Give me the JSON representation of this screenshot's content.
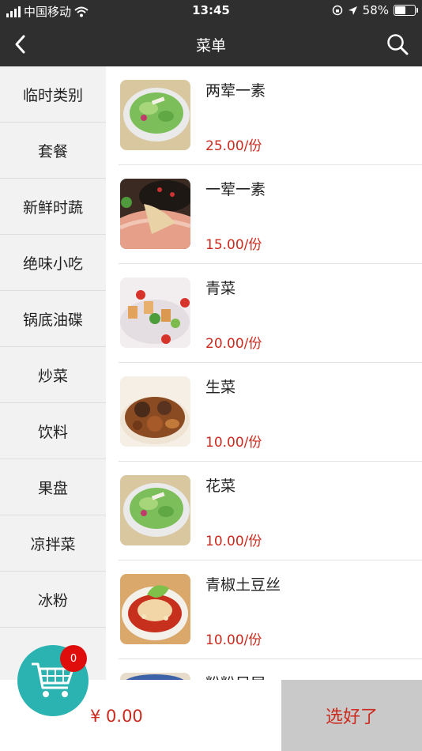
{
  "status_bar": {
    "carrier": "中国移动",
    "time": "13:45",
    "battery": "58%",
    "battery_level": 0.58
  },
  "nav": {
    "title": "菜单",
    "back_icon": "chevron-left-icon",
    "search_icon": "search-icon"
  },
  "categories": [
    {
      "label": "临时类别"
    },
    {
      "label": "套餐"
    },
    {
      "label": "新鲜时蔬"
    },
    {
      "label": "绝味小吃"
    },
    {
      "label": "锅底油碟"
    },
    {
      "label": "炒菜"
    },
    {
      "label": "饮料"
    },
    {
      "label": "果盘"
    },
    {
      "label": "凉拌菜"
    },
    {
      "label": "冰粉"
    }
  ],
  "dishes": [
    {
      "name": "两荤一素",
      "price": "25.00/份"
    },
    {
      "name": "一荤一素",
      "price": "15.00/份"
    },
    {
      "name": "青菜",
      "price": "20.00/份"
    },
    {
      "name": "生菜",
      "price": "10.00/份"
    },
    {
      "name": "花菜",
      "price": "10.00/份"
    },
    {
      "name": "青椒土豆丝",
      "price": "10.00/份"
    },
    {
      "name": "粉粉凤尾",
      "price": ""
    }
  ],
  "cart": {
    "count": "0",
    "total": "¥ 0.00",
    "confirm_label": "选好了"
  },
  "colors": {
    "nav_bg": "#2f2f2f",
    "price_red": "#cc2a1e",
    "cart_teal": "#2ab3b1",
    "badge_red": "#e00d0d",
    "confirm_bg": "#c9c9c9"
  }
}
